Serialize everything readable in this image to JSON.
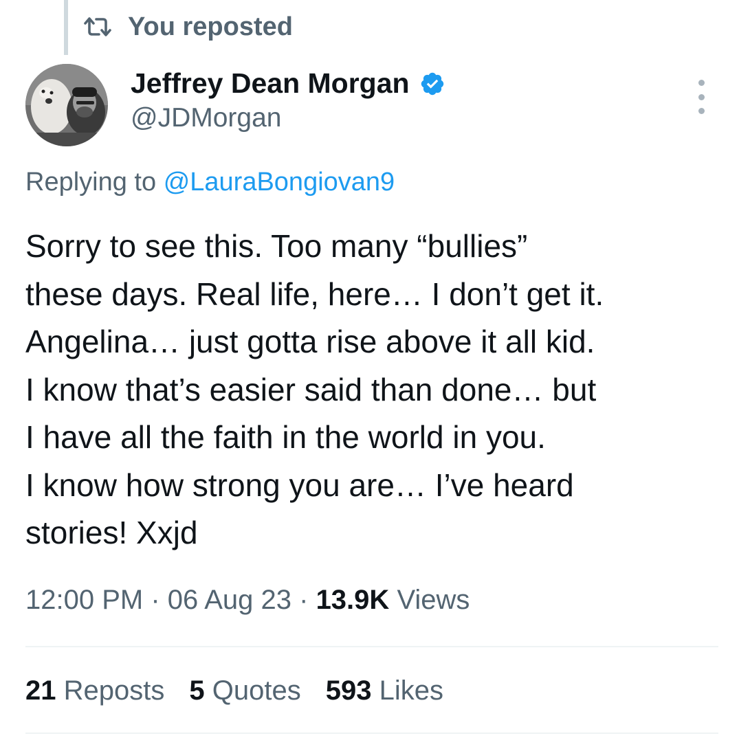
{
  "repost_header": {
    "icon": "repost-icon",
    "label": "You reposted"
  },
  "author": {
    "display_name": "Jeffrey Dean Morgan",
    "handle": "@JDMorgan",
    "verified_icon": "verified-badge-icon",
    "avatar": "avatar"
  },
  "reply": {
    "prefix": "Replying to",
    "mention": "@LauraBongiovan9"
  },
  "tweet": {
    "lines": [
      "Sorry to see this. Too many “bullies”",
      "these days. Real life, here… I don’t get it.",
      "Angelina… just gotta rise above it all kid.",
      "I know that’s easier said than done… but",
      "I have all the faith in the world in you.",
      "I know how strong you are… I’ve heard",
      "stories! Xxjd"
    ]
  },
  "meta": {
    "time": "12:00 PM",
    "date": "06 Aug 23",
    "views_count": "13.9K",
    "views_label": "Views",
    "separator": "·"
  },
  "stats": {
    "reposts_count": "21",
    "reposts_label": "Reposts",
    "quotes_count": "5",
    "quotes_label": "Quotes",
    "likes_count": "593",
    "likes_label": "Likes"
  },
  "colors": {
    "text_primary": "#0f1419",
    "text_secondary": "#536471",
    "link": "#1d9bf0",
    "verified": "#1d9bf0",
    "divider": "#eff3f4"
  }
}
